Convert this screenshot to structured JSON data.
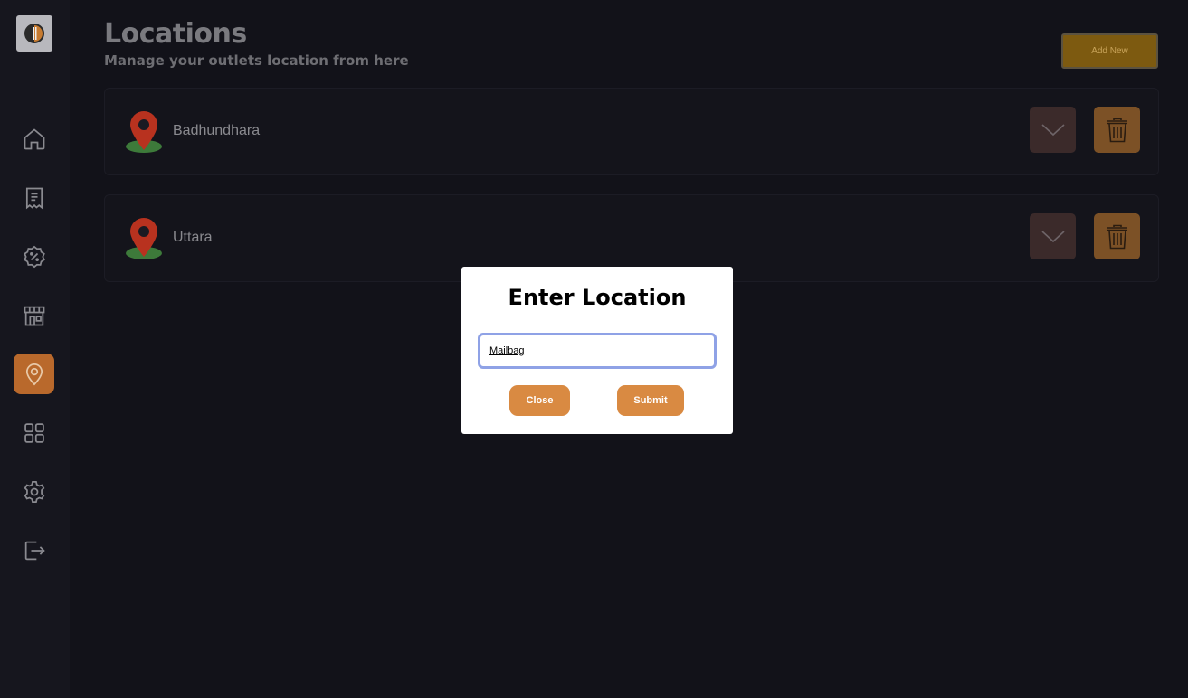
{
  "header": {
    "title": "Locations",
    "subtitle": "Manage your outlets location from here",
    "add_button_label": "Add New"
  },
  "sidebar": {
    "items": [
      {
        "name": "home-icon",
        "active": false
      },
      {
        "name": "receipt-icon",
        "active": false
      },
      {
        "name": "discount-icon",
        "active": false
      },
      {
        "name": "store-icon",
        "active": false
      },
      {
        "name": "location-icon",
        "active": true
      },
      {
        "name": "grid-icon",
        "active": false
      },
      {
        "name": "settings-icon",
        "active": false
      },
      {
        "name": "logout-icon",
        "active": false
      }
    ]
  },
  "locations": [
    {
      "name": "Badhundhara"
    },
    {
      "name": "Uttara"
    }
  ],
  "modal": {
    "title": "Enter Location",
    "input_value": "Mailbag",
    "close_label": "Close",
    "submit_label": "Submit"
  },
  "colors": {
    "accent": "#d98a42",
    "active_nav": "#b9692c",
    "background": "#121219"
  }
}
